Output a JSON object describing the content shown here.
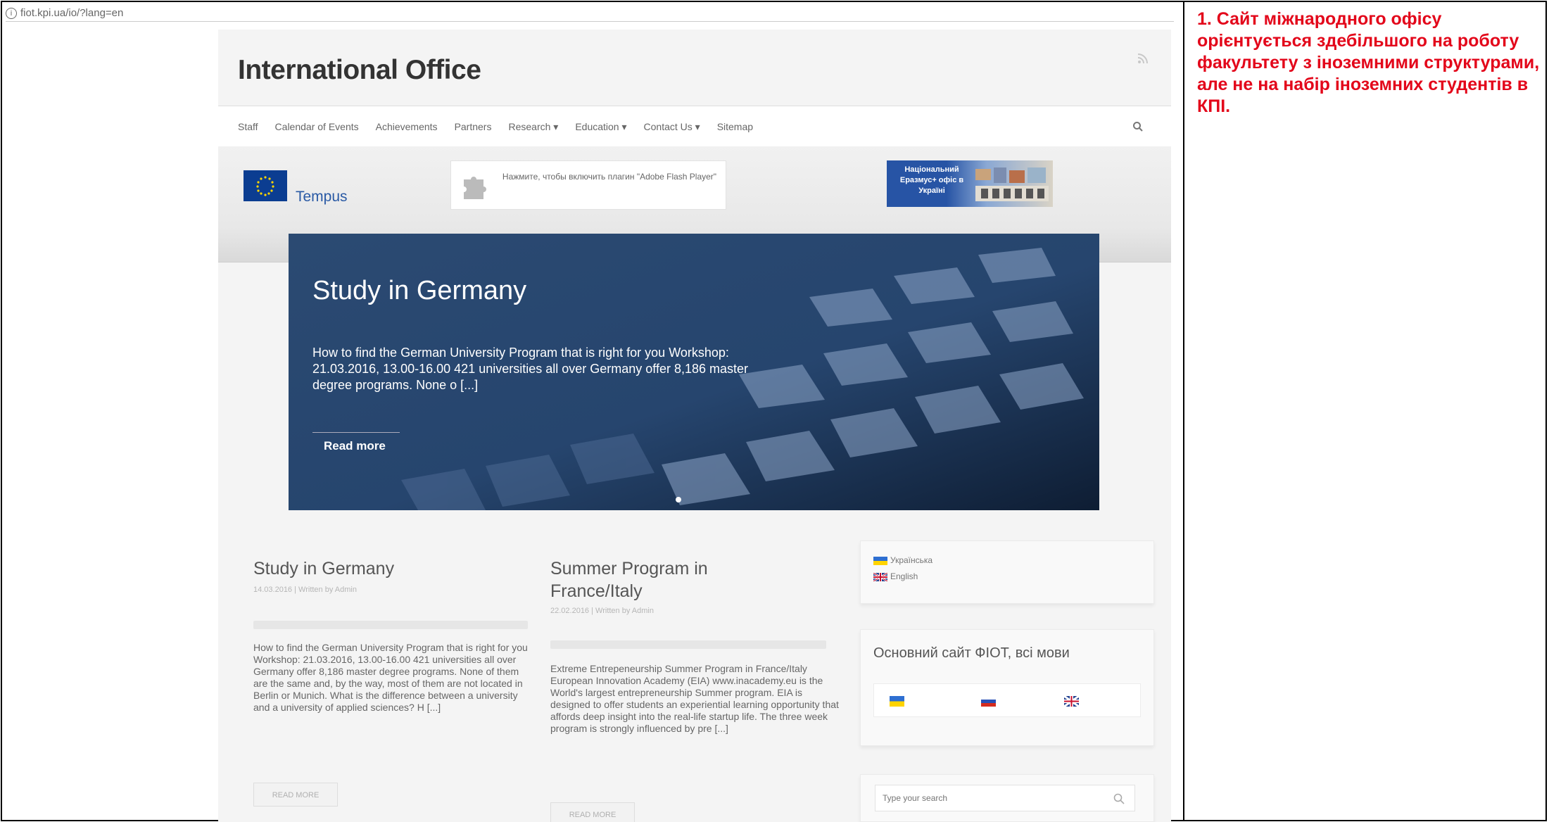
{
  "browser": {
    "url": "fiot.kpi.ua/io/?lang=en"
  },
  "site": {
    "title": "International Office",
    "nav": [
      {
        "label": "Staff"
      },
      {
        "label": "Calendar of Events"
      },
      {
        "label": "Achievements"
      },
      {
        "label": "Partners"
      },
      {
        "label": "Research ▾"
      },
      {
        "label": "Education ▾"
      },
      {
        "label": "Contact Us ▾"
      },
      {
        "label": "Sitemap"
      }
    ],
    "banner": {
      "tempus_label": "Tempus",
      "flash_text": "Нажмите, чтобы включить плагин \"Adobe Flash Player\"",
      "erasmus_text": "Національний Еразмус+ офіс в Україні"
    },
    "hero": {
      "title": "Study in Germany",
      "text": "How to find the German University Program that is right for you Workshop: 21.03.2016, 13.00-16.00 421 universities all over Germany offer 8,186 master degree programs. None o [...]",
      "read_more": "Read more"
    },
    "posts": [
      {
        "title": "Study in Germany",
        "meta": "14.03.2016  |  Written by Admin",
        "text": "How to find the German University Program that is right for you Workshop: 21.03.2016, 13.00-16.00 421 universities all over Germany offer 8,186 master degree programs. None of them are the same and, by the way, most of them are not located in Berlin or Munich. What is the difference between a university and a university of applied sciences? H [...]",
        "button": "READ MORE"
      },
      {
        "title": "Summer Program in France/Italy",
        "meta": "22.02.2016  |  Written by Admin",
        "text": "Extreme Entrepeneurship Summer Program in France/Italy European Innovation Academy (EIA) www.inacademy.eu is the World's largest entrepreneurship Summer program. EIA is designed to offer students an experiential learning opportunity that affords deep insight into the real-life startup life. The three week program is strongly influenced by pre [...]",
        "button": "READ MORE"
      }
    ],
    "sidebar": {
      "languages": [
        {
          "label": "Українська"
        },
        {
          "label": "English"
        }
      ],
      "main_site_title": "Основний сайт ФІОТ, всі мови",
      "search_placeholder": "Type your search"
    }
  },
  "annotation": {
    "text": "1. Сайт міжнародного офісу орієнтується здебільшого на роботу факультету з іноземними структурами, але не на набір іноземних студентів в КПІ."
  },
  "colors": {
    "annotation": "#e3061a",
    "eu_blue": "#0b3d91",
    "erasmus_blue": "#2754a5"
  }
}
